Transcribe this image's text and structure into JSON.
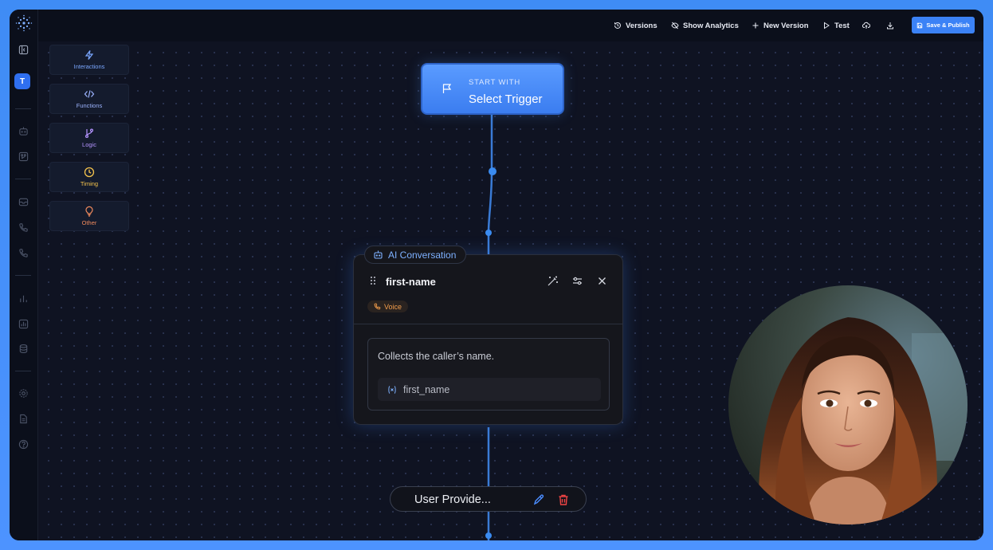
{
  "topbar": {
    "versions": "Versions",
    "show_analytics": "Show Analytics",
    "new_version": "New Version",
    "test": "Test",
    "save_publish": "Save & Publish"
  },
  "rail": {
    "avatar_letter": "T"
  },
  "palette": [
    {
      "label": "Interactions",
      "color": "#7aa7ff",
      "icon": "bolt-icon"
    },
    {
      "label": "Functions",
      "color": "#9db4ff",
      "icon": "code-icon"
    },
    {
      "label": "Logic",
      "color": "#b494ff",
      "icon": "branch-icon"
    },
    {
      "label": "Timing",
      "color": "#f4c34d",
      "icon": "clock-icon"
    },
    {
      "label": "Other",
      "color": "#f08a5d",
      "icon": "lightbulb-icon"
    }
  ],
  "trigger": {
    "sub": "START WITH",
    "main": "Select Trigger"
  },
  "ai_node": {
    "tag": "AI Conversation",
    "title": "first-name",
    "badge": "Voice",
    "description": "Collects the caller’s name.",
    "variable": "first_name"
  },
  "step": {
    "label": "User Provide..."
  },
  "colors": {
    "accent": "#3b82f6",
    "voice": "#f59e4b",
    "danger": "#ef4444"
  }
}
